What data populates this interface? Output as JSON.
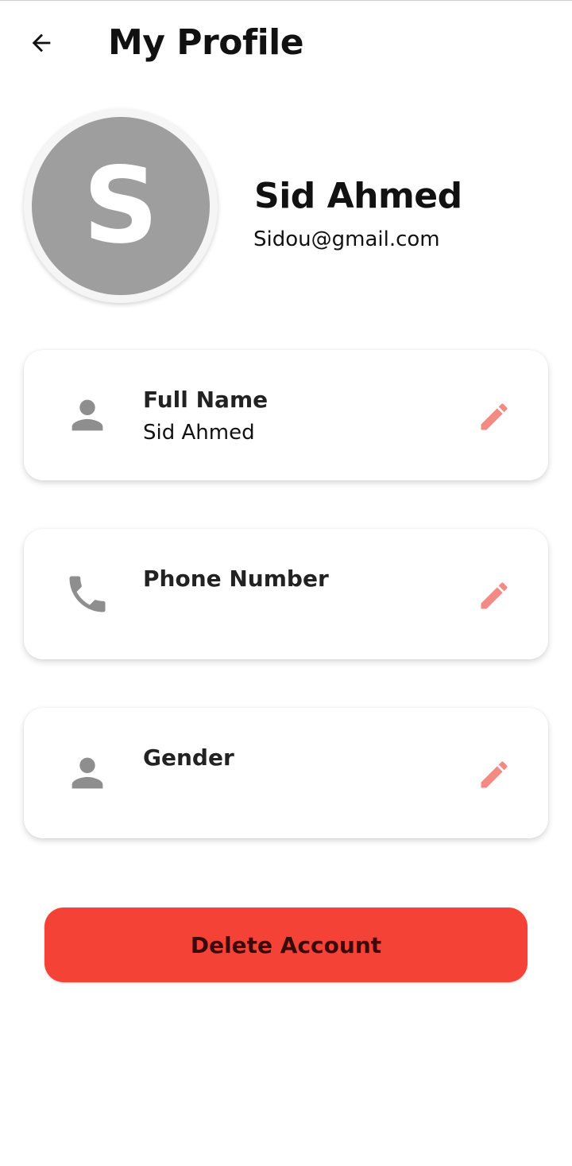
{
  "header": {
    "back_icon": "arrow-left-icon",
    "title": "My Profile"
  },
  "profile": {
    "avatar_initial": "S",
    "avatar_color": "#9e9e9e",
    "name": "Sid Ahmed",
    "email": "Sidou@gmail.com"
  },
  "fields": [
    {
      "icon": "person-icon",
      "label": "Full Name",
      "value": "Sid Ahmed",
      "edit_icon": "pencil-icon"
    },
    {
      "icon": "phone-icon",
      "label": "Phone Number",
      "value": "",
      "edit_icon": "pencil-icon"
    },
    {
      "icon": "person-icon",
      "label": "Gender",
      "value": "",
      "edit_icon": "pencil-icon"
    }
  ],
  "actions": {
    "delete_label": "Delete Account"
  },
  "colors": {
    "accent": "#f44336",
    "edit_icon": "#f48a84",
    "field_icon": "#8e8e8e"
  }
}
